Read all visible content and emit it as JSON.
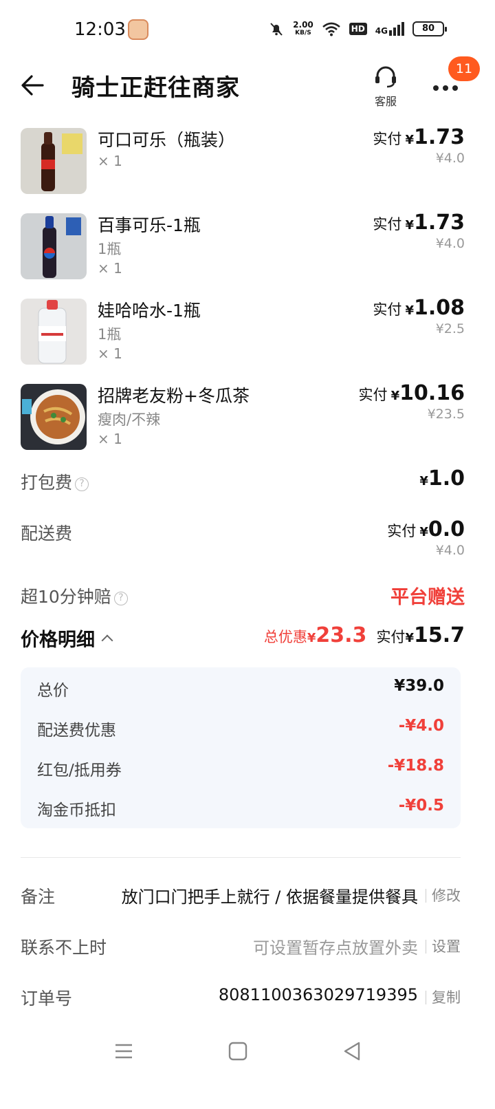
{
  "status_bar": {
    "time": "12:03",
    "net_speed_value": "2.00",
    "net_speed_unit": "KB/S",
    "hd": "HD",
    "signal": "4G",
    "battery": "80"
  },
  "header": {
    "title": "骑士正赶往商家",
    "customer_service_label": "客服",
    "badge_count": "11"
  },
  "items": [
    {
      "name": "可口可乐（瓶装）",
      "spec": "",
      "qty": "× 1",
      "paid_label": "实付",
      "yen": "¥",
      "paid": "1.73",
      "original": "¥4.0"
    },
    {
      "name": "百事可乐-1瓶",
      "spec": "1瓶",
      "qty": "× 1",
      "paid_label": "实付",
      "yen": "¥",
      "paid": "1.73",
      "original": "¥4.0"
    },
    {
      "name": "娃哈哈水-1瓶",
      "spec": "1瓶",
      "qty": "× 1",
      "paid_label": "实付",
      "yen": "¥",
      "paid": "1.08",
      "original": "¥2.5"
    },
    {
      "name": "招牌老友粉+冬瓜茶",
      "spec": "瘦肉/不辣",
      "qty": "× 1",
      "paid_label": "实付",
      "yen": "¥",
      "paid": "10.16",
      "original": "¥23.5"
    }
  ],
  "packing_fee": {
    "label": "打包费",
    "yen": "¥",
    "value": "1.0"
  },
  "delivery_fee": {
    "label": "配送费",
    "paid_label": "实付",
    "yen": "¥",
    "value": "0.0",
    "original": "¥4.0"
  },
  "late_compensation": {
    "label": "超10分钟赔",
    "value": "平台赠送"
  },
  "price_detail": {
    "title": "价格明细",
    "discount_label": "总优惠",
    "discount_yen": "¥",
    "discount_value": "23.3",
    "paid_label": "实付",
    "paid_yen": "¥",
    "paid_value": "15.7",
    "rows": [
      {
        "label": "总价",
        "value": "¥39.0"
      },
      {
        "label": "配送费优惠",
        "value": "-¥4.0"
      },
      {
        "label": "红包/抵用券",
        "value": "-¥18.8"
      },
      {
        "label": "淘金币抵扣",
        "value": "-¥0.5"
      }
    ]
  },
  "info": {
    "remark": {
      "label": "备注",
      "value": "放门口门把手上就行 / 依据餐量提供餐具",
      "action": "修改"
    },
    "unreachable": {
      "label": "联系不上时",
      "value": "可设置暂存点放置外卖",
      "action": "设置"
    },
    "order_no": {
      "label": "订单号",
      "value": "8081100363029719395",
      "action": "复制"
    }
  },
  "colors": {
    "accent_red": "#f0403a",
    "badge_orange": "#ff5a1f",
    "panel_bg": "#f4f7fc"
  }
}
